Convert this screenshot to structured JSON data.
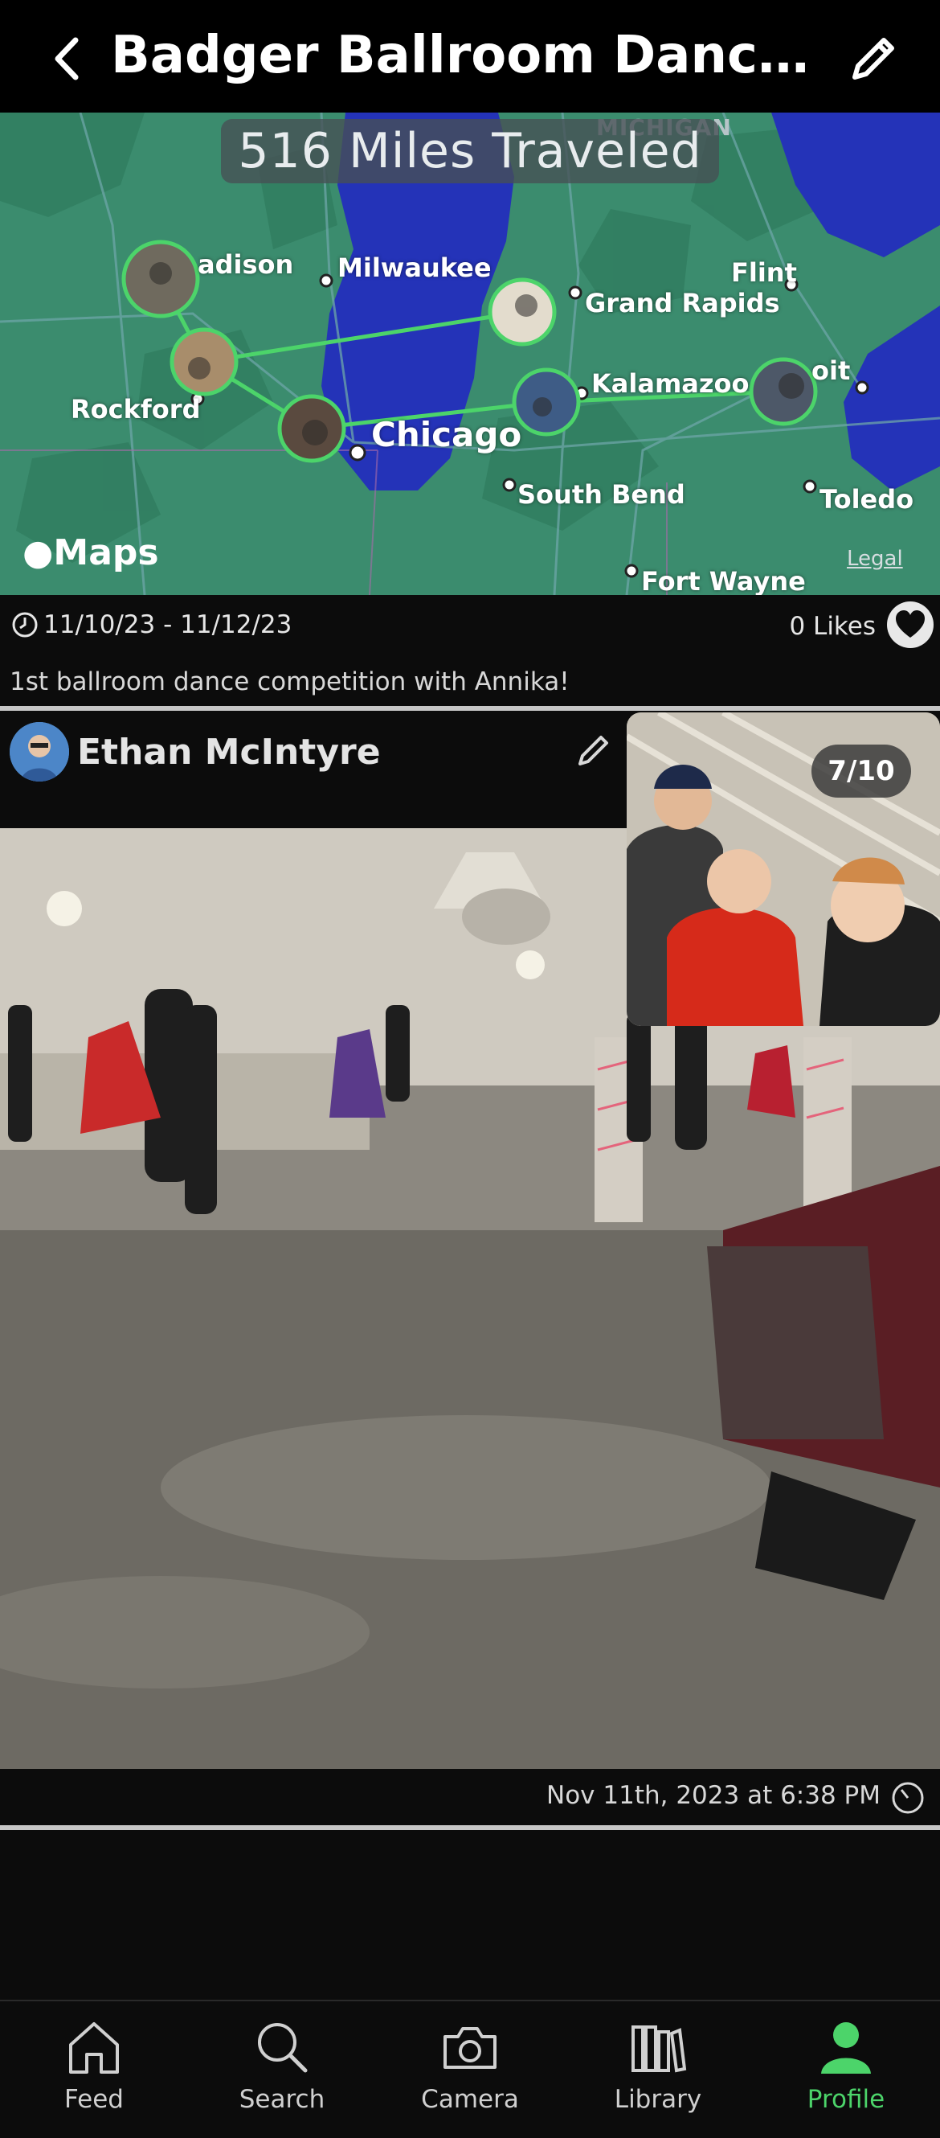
{
  "header": {
    "title": "Badger Ballroom Dances…"
  },
  "map": {
    "miles_label": "516 Miles Traveled",
    "attribution": "Maps",
    "legal": "Legal",
    "region_label": "MICHIGAN",
    "cities": {
      "madison": "adison",
      "milwaukee": "Milwaukee",
      "flint": "Flint",
      "grand_rapids": "Grand Rapids",
      "detroit": "oit",
      "kalamazoo": "Kalamazoo",
      "rockford": "Rockford",
      "chicago": "Chicago",
      "south_bend": "South Bend",
      "toledo": "Toledo",
      "fort_wayne": "Fort Wayne"
    },
    "route_color": "#4cd46a"
  },
  "trip": {
    "date_range": "11/10/23 - 11/12/23",
    "likes": "0 Likes",
    "caption": "1st ballroom dance competition with Annika!"
  },
  "post": {
    "author": "Ethan McIntyre",
    "photo_counter": "7/10",
    "timestamp": "Nov 11th, 2023 at 6:38 PM"
  },
  "tabs": [
    {
      "label": "Feed",
      "icon": "home-icon"
    },
    {
      "label": "Search",
      "icon": "search-icon"
    },
    {
      "label": "Camera",
      "icon": "camera-icon"
    },
    {
      "label": "Library",
      "icon": "library-icon"
    },
    {
      "label": "Profile",
      "icon": "person-icon",
      "active": true
    }
  ],
  "colors": {
    "accent": "#4cd46a",
    "background": "#0c0c0c",
    "map_land": "#3b8c6e",
    "lake": "#2433b8"
  }
}
